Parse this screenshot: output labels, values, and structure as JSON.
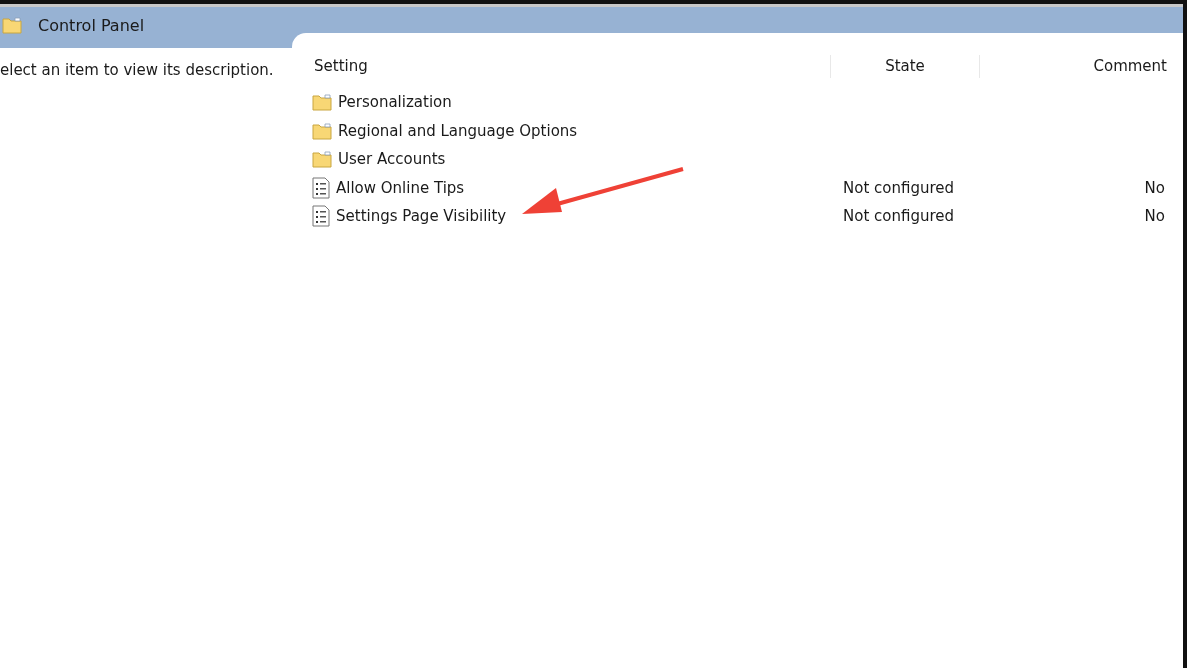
{
  "header": {
    "title": "Control Panel"
  },
  "description_pane": {
    "text": "elect an item to view its description."
  },
  "table": {
    "columns": [
      "Setting",
      "State",
      "Comment"
    ],
    "rows": [
      {
        "kind": "folder",
        "setting": "Personalization"
      },
      {
        "kind": "folder",
        "setting": "Regional and Language Options"
      },
      {
        "kind": "folder",
        "setting": "User Accounts"
      },
      {
        "kind": "policy",
        "setting": "Allow Online Tips",
        "state": "Not configured",
        "comment": "No"
      },
      {
        "kind": "policy",
        "setting": "Settings Page Visibility",
        "state": "Not configured",
        "comment": "No"
      }
    ]
  }
}
